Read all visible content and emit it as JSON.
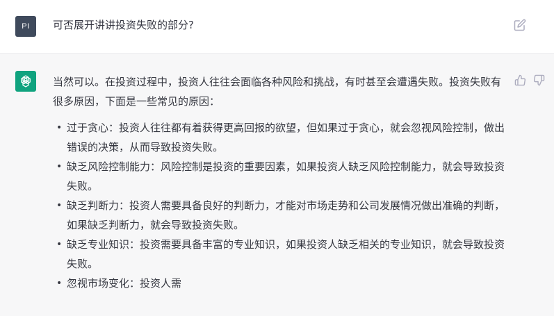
{
  "user_message": {
    "avatar_initials": "PI",
    "text": "可否展开讲讲投资失败的部分?"
  },
  "assistant_message": {
    "intro": "当然可以。在投资过程中，投资人往往会面临各种风险和挑战，有时甚至会遭遇失败。投资失败有很多原因，下面是一些常见的原因：",
    "bullet_glyph": "•",
    "items": [
      {
        "text": "过于贪心：投资人往往都有着获得更高回报的欲望，但如果过于贪心，就会忽视风险控制，做出错误的决策，从而导致投资失败。"
      },
      {
        "text": "缺乏风险控制能力：风险控制是投资的重要因素，如果投资人缺乏风险控制能力，就会导致投资失败。"
      },
      {
        "text": "缺乏判断力：投资人需要具备良好的判断力，才能对市场走势和公司发展情况做出准确的判断，如果缺乏判断力，就会导致投资失败。"
      },
      {
        "text": "缺乏专业知识：投资需要具备丰富的专业知识，如果投资人缺乏相关的专业知识，就会导致投资失败。"
      },
      {
        "text": "忽视市场变化：投资人需"
      }
    ]
  },
  "icons": {
    "edit": "edit-icon",
    "thumbs_up": "thumbs-up-icon",
    "thumbs_down": "thumbs-down-icon",
    "assistant_logo": "openai-logo-icon"
  },
  "colors": {
    "user_avatar_bg": "#3f4a5c",
    "assistant_avatar_bg": "#10a37f",
    "assistant_row_bg": "#f7f7f8",
    "text": "#353740"
  }
}
